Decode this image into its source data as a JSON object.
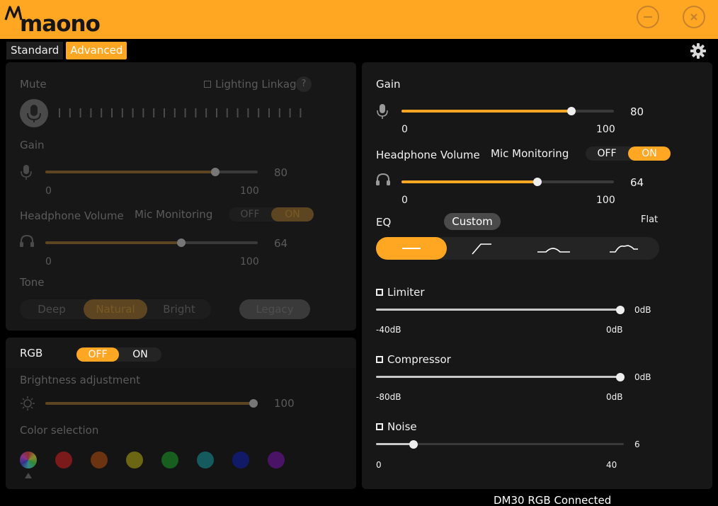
{
  "app": {
    "logo_text": "maono"
  },
  "tabs": [
    {
      "label": "Standard",
      "active": false
    },
    {
      "label": "Advanced",
      "active": true
    }
  ],
  "left_panel": {
    "mute_label": "Mute",
    "lighting_linkage_label": "Lighting Linkage",
    "help_glyph": "?",
    "gain": {
      "label": "Gain",
      "value": "80",
      "min": "0",
      "max": "100",
      "fraction": 0.8
    },
    "headphone": {
      "label": "Headphone Volume",
      "value": "64",
      "min": "0",
      "max": "100",
      "fraction": 0.64
    },
    "mic_monitoring": {
      "label": "Mic Monitoring",
      "off": "OFF",
      "on": "ON",
      "selected": "ON"
    },
    "tone": {
      "label": "Tone",
      "options": [
        "Deep",
        "Natural",
        "Bright"
      ],
      "selected": "Natural",
      "legacy": "Legacy"
    }
  },
  "rgb_panel": {
    "label": "RGB",
    "toggle": {
      "off": "OFF",
      "on": "ON",
      "selected": "OFF"
    },
    "brightness": {
      "label": "Brightness adjustment",
      "value": "100",
      "fraction": 1.0
    },
    "color_label": "Color selection",
    "colors": [
      "#7a1a1a",
      "#6b3310",
      "#6b6614",
      "#175e1f",
      "#155a5c",
      "#111a66",
      "#4a1366"
    ]
  },
  "right_panel": {
    "gain": {
      "label": "Gain",
      "value": "80",
      "min": "0",
      "max": "100",
      "fraction": 0.8
    },
    "headphone": {
      "label": "Headphone Volume",
      "value": "64",
      "min": "0",
      "max": "100",
      "fraction": 0.64
    },
    "mic_monitoring": {
      "label": "Mic Monitoring",
      "off": "OFF",
      "on": "ON",
      "selected": "ON"
    },
    "eq": {
      "label": "EQ",
      "preset": "Custom",
      "current": "Flat",
      "options": [
        "flat-curve-icon",
        "high-pass-curve-icon",
        "mid-boost-curve-icon",
        "presence-curve-icon"
      ],
      "selected": 0
    },
    "limiter": {
      "label": "Limiter",
      "value": "0dB",
      "min": "-40dB",
      "max": "0dB",
      "fraction": 1.0
    },
    "compressor": {
      "label": "Compressor",
      "value": "0dB",
      "min": "-80dB",
      "max": "0dB",
      "fraction": 1.0
    },
    "noise": {
      "label": "Noise",
      "value": "6",
      "min": "0",
      "max": "40",
      "fraction": 0.15
    }
  },
  "status": {
    "text": "DM30 RGB Connected"
  },
  "colors": {
    "accent": "#ffa623",
    "panel": "#171717",
    "background": "#000000"
  }
}
